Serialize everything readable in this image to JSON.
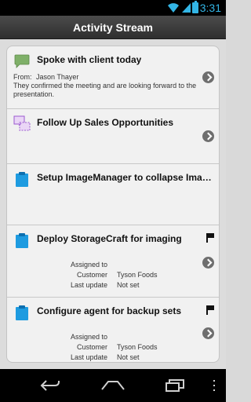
{
  "statusbar": {
    "time": "3:31"
  },
  "header": {
    "title": "Activity Stream"
  },
  "items": [
    {
      "title": "Spoke with client today",
      "icon": "speech-bubble-icon",
      "from_label": "From:",
      "from_value": "Jason Thayer",
      "description": "They confirmed the meeting and are looking forward to the presentation."
    },
    {
      "title": "Follow Up Sales Opportunities",
      "icon": "opportunity-icon"
    },
    {
      "title": "Setup ImageManager to collapse Image c...",
      "icon": "clipboard-icon"
    },
    {
      "title": "Deploy StorageCraft for imaging",
      "icon": "clipboard-icon",
      "flag": "flag-icon",
      "fields": [
        {
          "label": "Assigned to",
          "value": ""
        },
        {
          "label": "Customer",
          "value": "Tyson Foods"
        },
        {
          "label": "Last update",
          "value": "Not set"
        }
      ]
    },
    {
      "title": "Configure agent for backup sets",
      "icon": "clipboard-icon",
      "flag": "flag-icon",
      "fields": [
        {
          "label": "Assigned to",
          "value": ""
        },
        {
          "label": "Customer",
          "value": "Tyson Foods"
        },
        {
          "label": "Last update",
          "value": "Not set"
        }
      ]
    }
  ],
  "navbar": {
    "buttons": [
      "back-icon",
      "home-icon",
      "recent-apps-icon",
      "overflow-menu-icon"
    ]
  },
  "colors": {
    "accent": "#33b5e5",
    "clipboard": "#1e9be0",
    "bubble": "#7fb069",
    "opportunity": "#9b59d0"
  }
}
